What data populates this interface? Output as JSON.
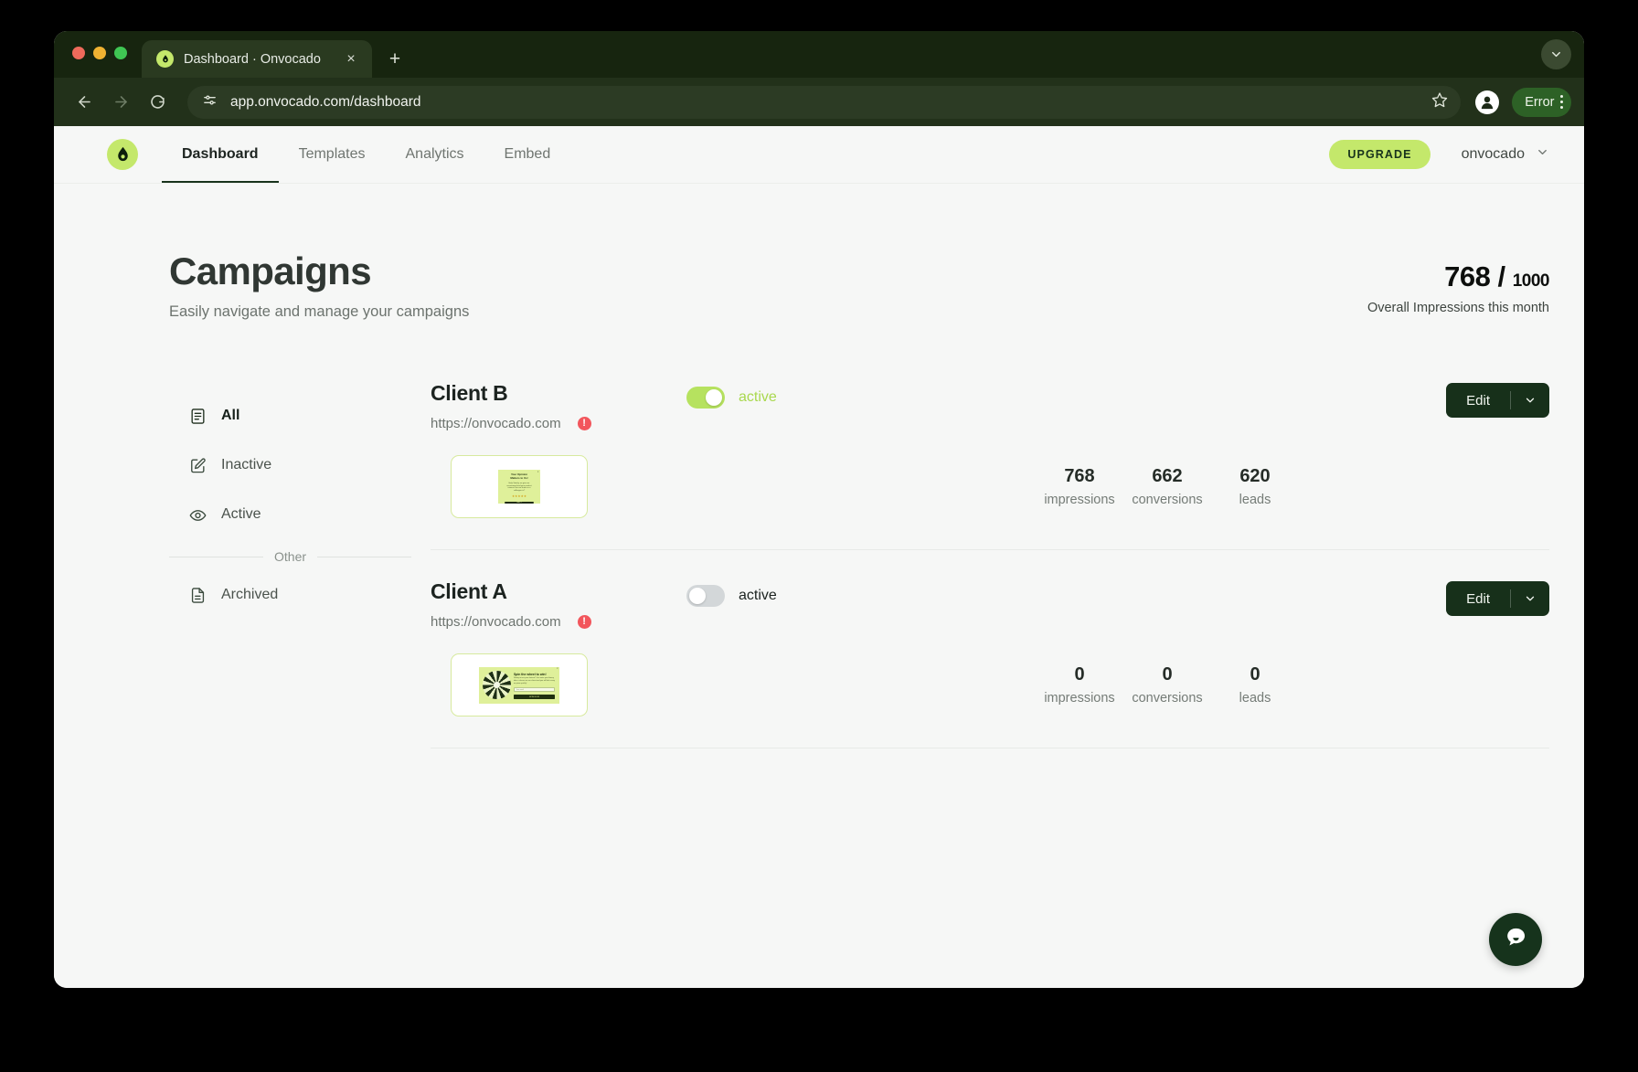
{
  "browser": {
    "tab": {
      "title": "Dashboard · Onvocado",
      "favicon": "avocado-icon",
      "close": "×"
    },
    "new_tab": "+",
    "toolbar": {
      "back": "←",
      "forward": "→",
      "reload": "⟳",
      "site_info_icon": "site-settings-icon",
      "url": "app.onvocado.com/dashboard",
      "star_icon": "bookmark-star-icon",
      "profile_icon": "profile-avatar-icon",
      "error_label": "Error",
      "menu_icon": "kebab-menu-icon"
    },
    "tab_overflow_icon": "chevron-down-icon"
  },
  "app_nav": {
    "logo": "onvocado-avocado-logo",
    "tabs": [
      {
        "label": "Dashboard",
        "active": true
      },
      {
        "label": "Templates",
        "active": false
      },
      {
        "label": "Analytics",
        "active": false
      },
      {
        "label": "Embed",
        "active": false
      }
    ],
    "upgrade_label": "UPGRADE",
    "account_name": "onvocado",
    "account_caret": "chevron-down-icon"
  },
  "header": {
    "title": "Campaigns",
    "subtitle": "Easily navigate and manage your campaigns",
    "impressions_used": "768",
    "impressions_separator": " / ",
    "impressions_total": "1000",
    "impressions_caption": "Overall Impressions this month"
  },
  "filters": {
    "items": [
      {
        "label": "All",
        "icon": "document-list-icon",
        "active": true
      },
      {
        "label": "Inactive",
        "icon": "pencil-square-icon",
        "active": false
      },
      {
        "label": "Active",
        "icon": "eye-icon",
        "active": false
      }
    ],
    "group_label": "Other",
    "other_items": [
      {
        "label": "Archived",
        "icon": "document-icon",
        "active": false
      }
    ]
  },
  "campaigns": [
    {
      "name": "Client B",
      "url": "https://onvocado.com",
      "warning": "!",
      "toggle_on": true,
      "toggle_label": "active",
      "edit_label": "Edit",
      "edit_caret": "chevron-down-icon",
      "preview": {
        "type": "opinion-popup",
        "heading": "Your Opinion Matters to Us!",
        "body": "Help Satisfy, we give our recommend and your product interest Can we share as a colleague in?",
        "stars": "★★★★★",
        "cta": "NEXT",
        "close": "×"
      },
      "stats": [
        {
          "value": "768",
          "label": "impressions"
        },
        {
          "value": "662",
          "label": "conversions"
        },
        {
          "value": "620",
          "label": "leads"
        }
      ]
    },
    {
      "name": "Client A",
      "url": "https://onvocado.com",
      "warning": "!",
      "toggle_on": false,
      "toggle_label": "active",
      "edit_label": "Edit",
      "edit_caret": "chevron-down-icon",
      "preview": {
        "type": "spin-wheel-popup",
        "heading": "Spin the wheel to win!",
        "body": "Ready to test your fortune? Just enter your binary take a chance on our shiest and you will lock crazy on prize quickly!",
        "field_placeholder": "Your email",
        "cta": "SPIN NOW",
        "close": "×"
      },
      "stats": [
        {
          "value": "0",
          "label": "impressions"
        },
        {
          "value": "0",
          "label": "conversions"
        },
        {
          "value": "0",
          "label": "leads"
        }
      ]
    }
  ],
  "chat": {
    "icon": "chat-bubble-icon"
  },
  "colors": {
    "brand_green": "#c4e86b",
    "dark_green": "#17301a",
    "browser_chrome": "#22311a",
    "danger_red": "#f2565c"
  }
}
